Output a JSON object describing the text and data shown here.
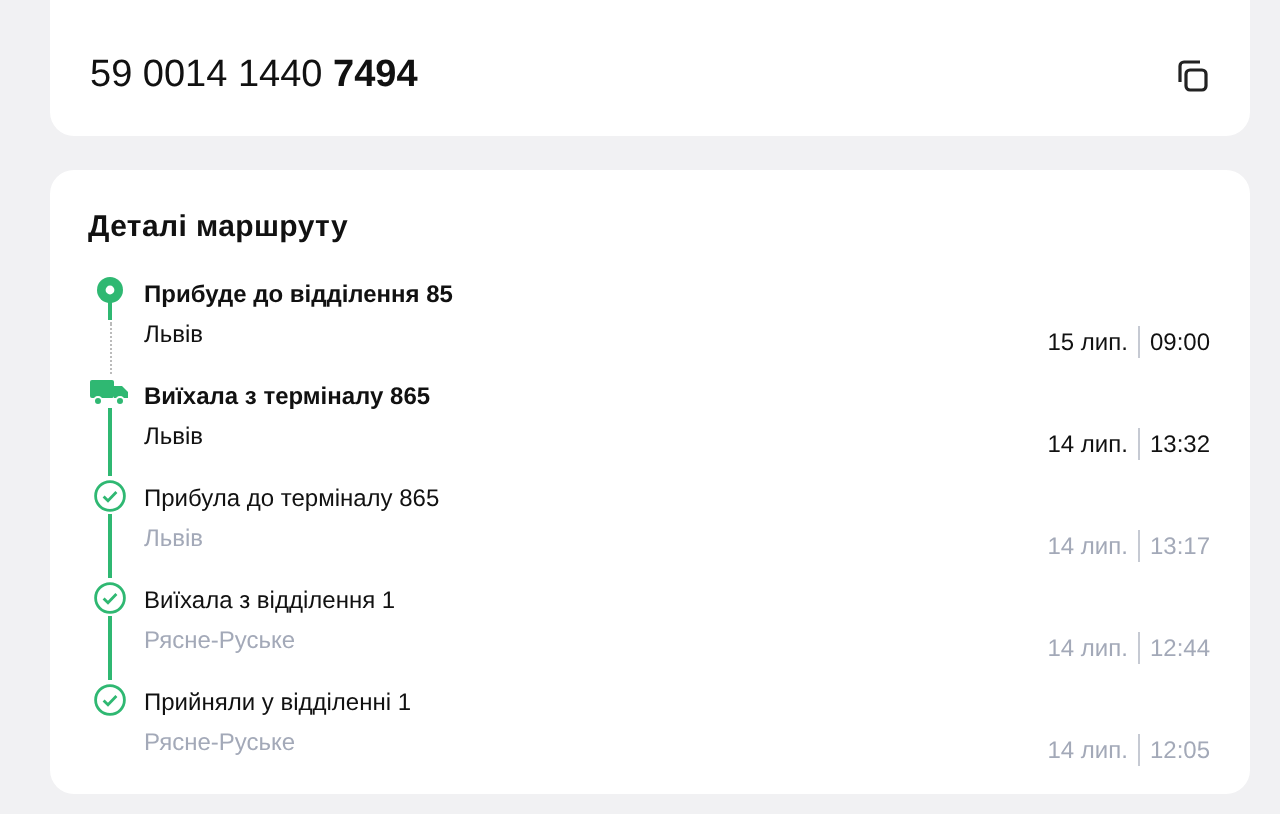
{
  "tracking": {
    "number": "59 0014 1440 **7494**"
  },
  "route": {
    "title": "Деталі маршруту",
    "steps": [
      {
        "kind": "pin",
        "title": "Прибуде до відділення 85",
        "place": "Львів",
        "date": "15 лип.",
        "time": "09:00",
        "highlighted": true
      },
      {
        "kind": "truck",
        "title": "Виїхала з терміналу 865",
        "place": "Львів",
        "date": "14 лип.",
        "time": "13:32",
        "highlighted": true
      },
      {
        "kind": "check",
        "title": "Прибула до терміналу 865",
        "place": "Львів",
        "date": "14 лип.",
        "time": "13:17",
        "highlighted": false
      },
      {
        "kind": "check",
        "title": "Виїхала з відділення 1",
        "place": "Рясне-Руське",
        "date": "14 лип.",
        "time": "12:44",
        "highlighted": false
      },
      {
        "kind": "check",
        "title": "Прийняли у відділенні 1",
        "place": "Рясне-Руське",
        "date": "14 лип.",
        "time": "12:05",
        "highlighted": false
      }
    ]
  }
}
